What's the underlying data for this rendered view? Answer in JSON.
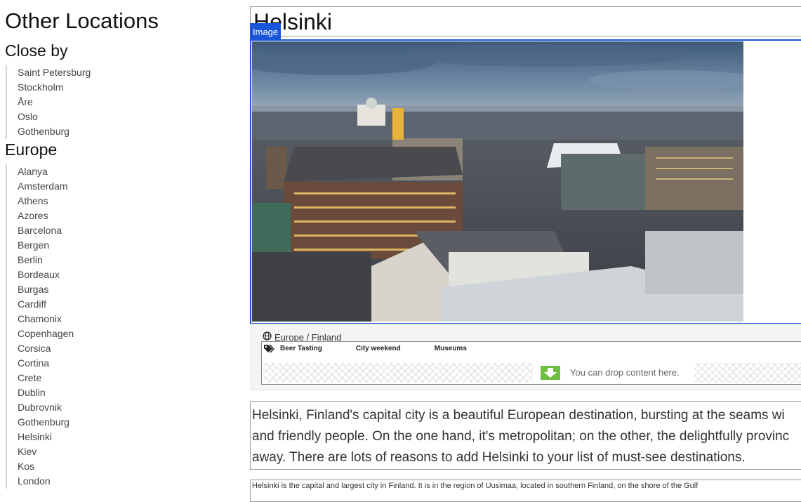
{
  "sidebar": {
    "title": "Other Locations",
    "close_by": {
      "heading": "Close by",
      "items": [
        "Saint Petersburg",
        "Stockholm",
        "Åre",
        "Oslo",
        "Gothenburg"
      ]
    },
    "europe": {
      "heading": "Europe",
      "items": [
        "Alanya",
        "Amsterdam",
        "Athens",
        "Azores",
        "Barcelona",
        "Bergen",
        "Berlin",
        "Bordeaux",
        "Burgas",
        "Cardiff",
        "Chamonix",
        "Copenhagen",
        "Corsica",
        "Cortina",
        "Crete",
        "Dublin",
        "Dubrovnik",
        "Gothenburg",
        "Helsinki",
        "Kiev",
        "Kos",
        "London"
      ]
    }
  },
  "main": {
    "title": "Helsinki",
    "image_tag": "Image",
    "breadcrumb": "Europe / Finland",
    "tags": [
      "Beer Tasting",
      "City weekend",
      "Museums"
    ],
    "drop_text": "You can drop content here.",
    "paragraph_lines": [
      "Helsinki, Finland's capital city is a beautiful European destination, bursting at the seams wi",
      "and friendly people. On the one hand, it's metropolitan; on the other, the delightfully provinc",
      "away. There are lots of reasons to add Helsinki to your list of must-see destinations."
    ],
    "paragraph2": "Helsinki is the capital and largest city in Finland. It is in the region of Uusimaa, located in southern Finland, on the shore of the Gulf"
  },
  "colors": {
    "accent": "#1a56db",
    "drop_icon": "#6fbe44",
    "meta_bg": "#f4f4f4"
  }
}
